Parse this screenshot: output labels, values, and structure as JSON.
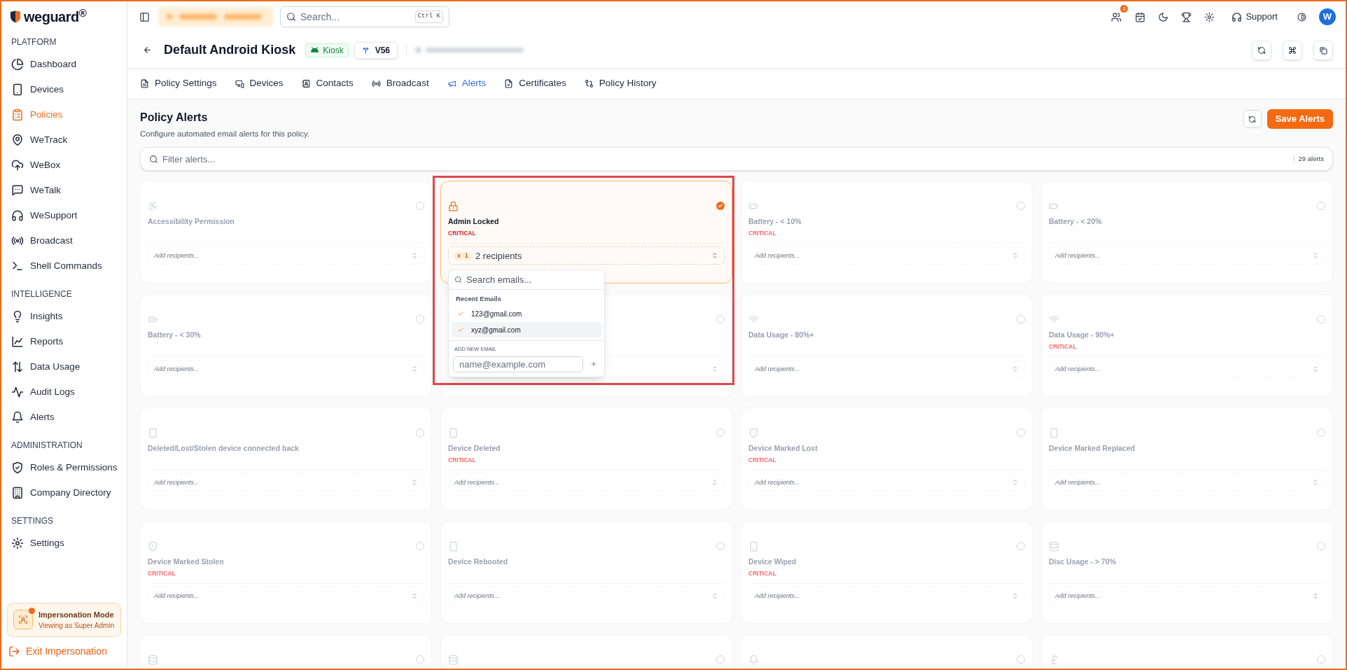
{
  "sidebar": {
    "logo": "weguard$^{®}$",
    "sections": [
      {
        "title": "PLATFORM",
        "items": [
          {
            "label": "Dashboard",
            "kind": "pie",
            "selected": false
          },
          {
            "label": "Devices",
            "kind": "phone",
            "selected": false
          },
          {
            "label": "Policies",
            "kind": "clipboard",
            "selected": true
          },
          {
            "label": "WeTrack",
            "kind": "pin",
            "selected": false
          },
          {
            "label": "WeBox",
            "kind": "cloud",
            "selected": false
          },
          {
            "label": "WeTalk",
            "kind": "chat",
            "selected": false
          },
          {
            "label": "WeSupport",
            "kind": "headset",
            "selected": false
          },
          {
            "label": "Broadcast",
            "kind": "radio",
            "selected": false
          },
          {
            "label": "Shell Commands",
            "kind": "terminal",
            "selected": false
          }
        ]
      },
      {
        "title": "INTELLIGENCE",
        "items": [
          {
            "label": "Insights",
            "kind": "bulb",
            "selected": false
          },
          {
            "label": "Reports",
            "kind": "chart",
            "selected": false
          },
          {
            "label": "Data Usage",
            "kind": "updown",
            "selected": false
          },
          {
            "label": "Audit Logs",
            "kind": "activity",
            "selected": false
          },
          {
            "label": "Alerts",
            "kind": "bell",
            "selected": false
          }
        ]
      },
      {
        "title": "ADMINISTRATION",
        "items": [
          {
            "label": "Roles & Permissions",
            "kind": "shieldcheck",
            "selected": false
          },
          {
            "label": "Company Directory",
            "kind": "building",
            "selected": false
          }
        ]
      },
      {
        "title": "SETTINGS",
        "items": [
          {
            "label": "Settings",
            "kind": "gear",
            "selected": false
          }
        ]
      }
    ]
  },
  "impersonation": {
    "title": "Impersonation Mode",
    "subtitle": "Viewing as Super Admin"
  },
  "exit_link": "Exit Impersonation",
  "topbar": {
    "search_placeholder": "Search...",
    "shortcut": "Ctrl K",
    "notification_count": "1",
    "support": "Support",
    "avatar": "W"
  },
  "policy": {
    "title": "Default Android Kiosk",
    "platform_badge": "Kiosk",
    "version": "V56"
  },
  "tabs": [
    {
      "label": "Policy Settings",
      "kind": "file",
      "selected": false
    },
    {
      "label": "Devices",
      "kind": "monitorphone",
      "selected": false
    },
    {
      "label": "Contacts",
      "kind": "contact",
      "selected": false
    },
    {
      "label": "Broadcast",
      "kind": "radio",
      "selected": false
    },
    {
      "label": "Alerts",
      "kind": "megaphone",
      "selected": true
    },
    {
      "label": "Certificates",
      "kind": "filecheck",
      "selected": false
    },
    {
      "label": "Policy History",
      "kind": "compare",
      "selected": false
    }
  ],
  "alerts": {
    "title": "Policy Alerts",
    "subtitle": "Configure automated email alerts for this policy.",
    "save": "Save Alerts",
    "filter_placeholder": "Filter alerts...",
    "count": "29 alerts",
    "highlight_frame": true,
    "cards": [
      {
        "kind": "accessibility",
        "title": "Accessibility Permission",
        "enabled": false,
        "recipients": "Add recipients..."
      },
      {
        "kind": "lock",
        "title": "Admin Locked",
        "severity": "CRITICAL",
        "enabled": true,
        "recipients": "2 recipients",
        "recipient_initials": [
          "x",
          "1"
        ],
        "expanded": true
      },
      {
        "kind": "battery",
        "title": "Battery - < 10%",
        "severity": "CRITICAL",
        "enabled": false,
        "recipients": "Add recipients..."
      },
      {
        "kind": "battery",
        "title": "Battery - < 20%",
        "enabled": false,
        "recipients": "Add recipients..."
      },
      {
        "kind": "batteryfull",
        "title": "Battery - < 30%",
        "enabled": false,
        "recipients": "Add recipients..."
      },
      {
        "enabled": false
      },
      {
        "kind": "wifi",
        "title": "Data Usage - 80%+",
        "enabled": false,
        "recipients": "Add recipients..."
      },
      {
        "kind": "wifi",
        "title": "Data Usage - 90%+",
        "severity": "CRITICAL",
        "enabled": false,
        "recipients": "Add recipients..."
      },
      {
        "kind": "phone",
        "title": "Deleted/Lost/Stolen device connected back",
        "enabled": false,
        "recipients": "Add recipients..."
      },
      {
        "kind": "phone",
        "title": "Device Deleted",
        "severity": "CRITICAL",
        "enabled": false,
        "recipients": "Add recipients..."
      },
      {
        "kind": "shield",
        "title": "Device Marked Lost",
        "severity": "CRITICAL",
        "enabled": false,
        "recipients": "Add recipients..."
      },
      {
        "kind": "phone",
        "title": "Device Marked Replaced",
        "enabled": false,
        "recipients": "Add recipients..."
      },
      {
        "kind": "shield",
        "title": "Device Marked Stolen",
        "severity": "CRITICAL",
        "enabled": false,
        "recipients": "Add recipients..."
      },
      {
        "kind": "phone",
        "title": "Device Rebooted",
        "enabled": false,
        "recipients": "Add recipients..."
      },
      {
        "kind": "phone",
        "title": "Device Wiped",
        "severity": "CRITICAL",
        "enabled": false,
        "recipients": "Add recipients..."
      },
      {
        "kind": "database",
        "title": "Disc Usage - > 70%",
        "enabled": false,
        "recipients": "Add recipients..."
      },
      {
        "kind": "database",
        "enabled": false
      },
      {
        "kind": "database",
        "enabled": false
      },
      {
        "kind": "bell",
        "enabled": false
      },
      {
        "kind": "pound",
        "enabled": false
      }
    ]
  },
  "recipient_dropdown": {
    "search_placeholder": "Search emails...",
    "recent_label": "Recent Emails",
    "emails": [
      {
        "address": "123@gmail.com",
        "checked": true,
        "selected": false
      },
      {
        "address": "xyz@gmail.com",
        "checked": true,
        "selected": true
      }
    ],
    "add_label": "ADD NEW EMAIL",
    "add_placeholder": "name@example.com"
  }
}
